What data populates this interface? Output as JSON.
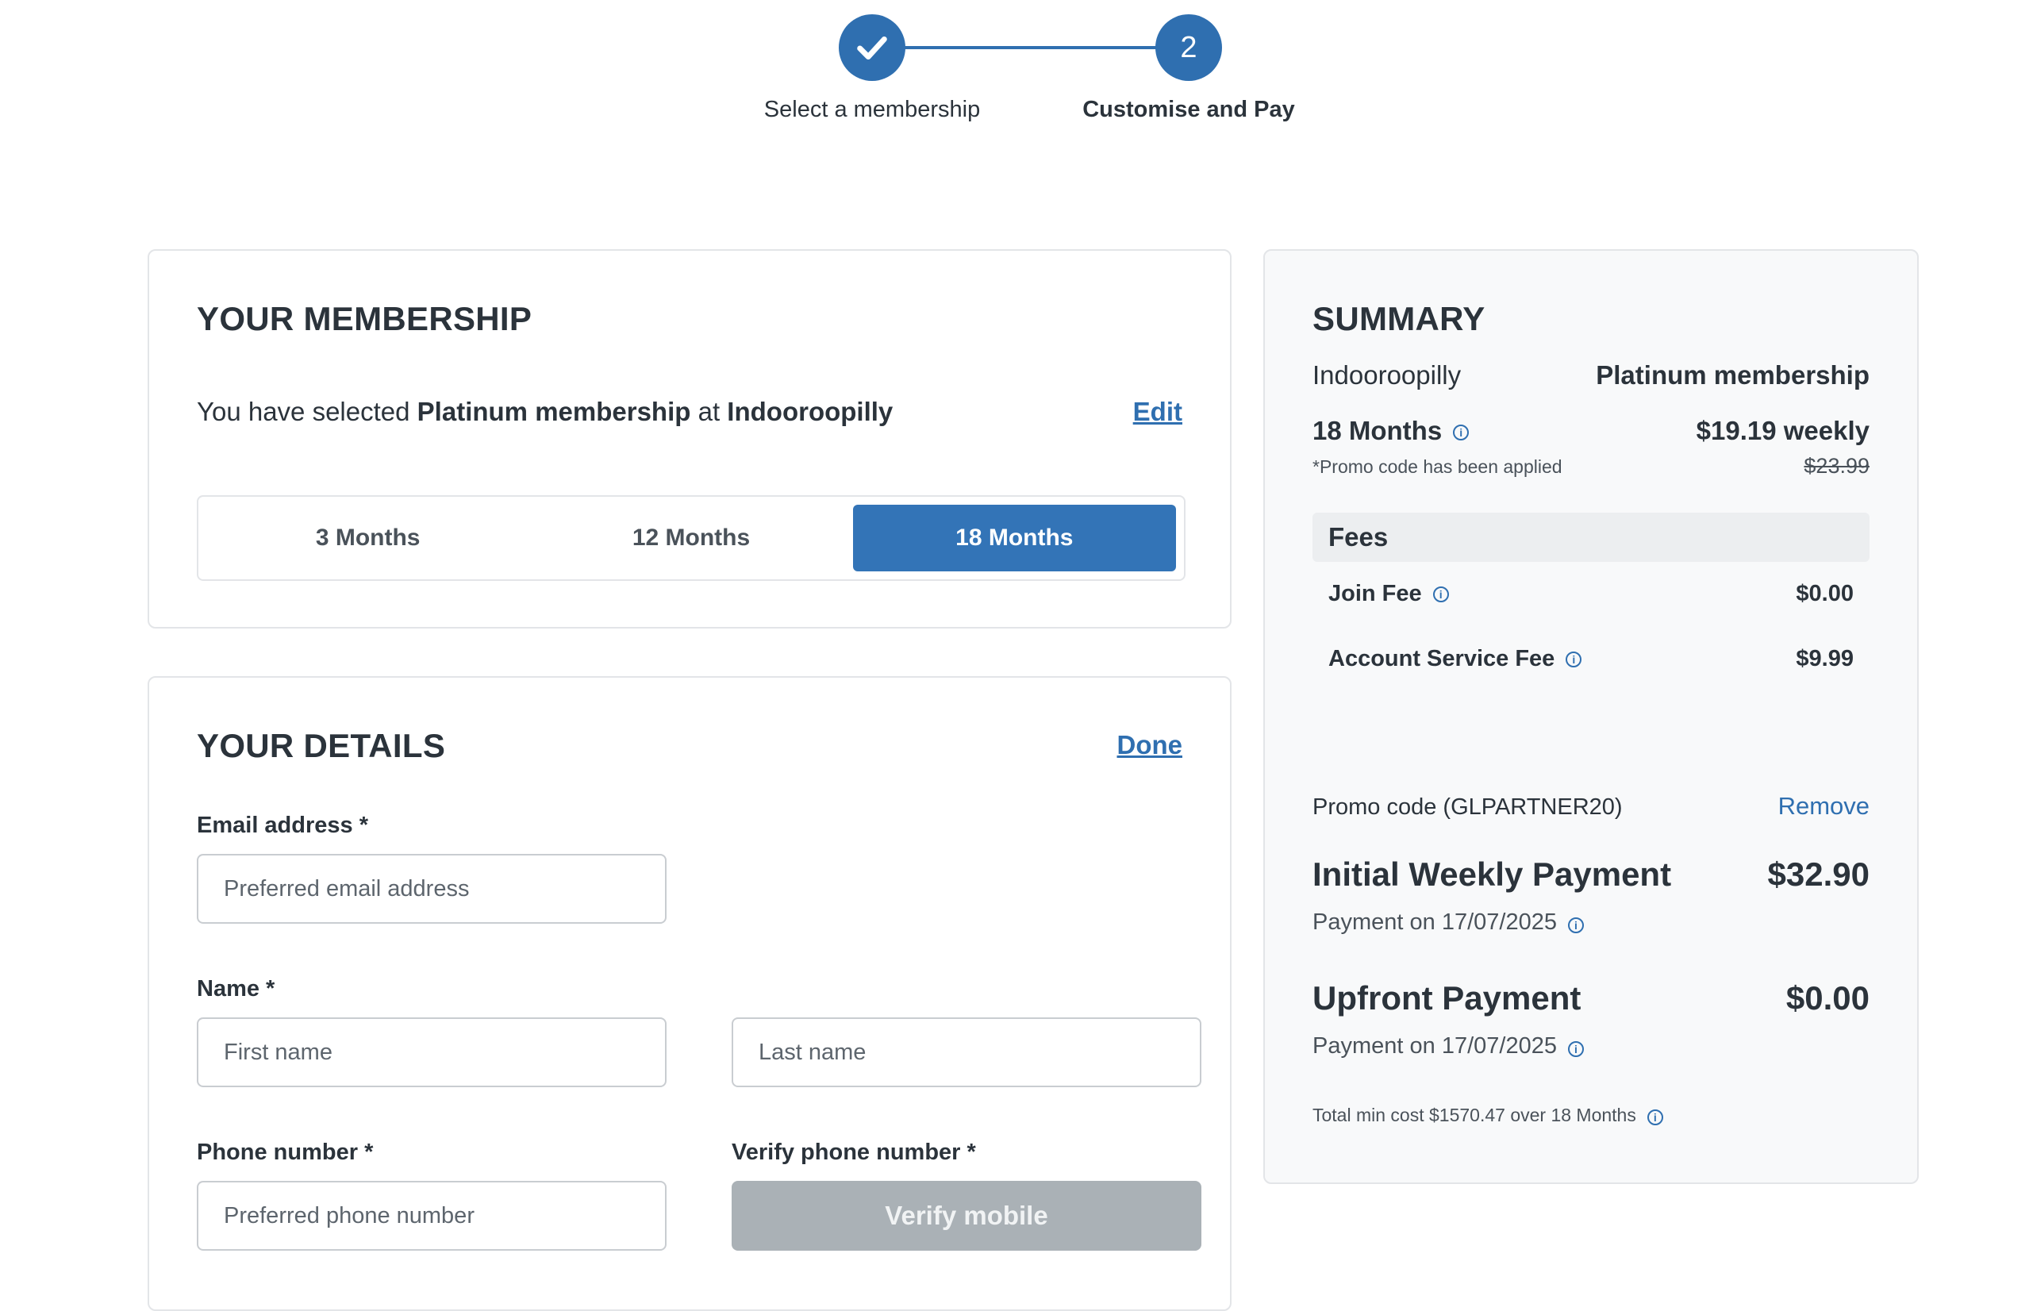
{
  "stepper": {
    "step1_label": "Select a membership",
    "step2_number": "2",
    "step2_label": "Customise and Pay"
  },
  "membership": {
    "title": "YOUR MEMBERSHIP",
    "selected_prefix": "You have selected",
    "plan": "Platinum membership",
    "at": "at",
    "location": "Indooroopilly",
    "edit_label": "Edit",
    "durations": [
      "3 Months",
      "12 Months",
      "18 Months"
    ],
    "selected_duration": "18 Months"
  },
  "details": {
    "title": "YOUR DETAILS",
    "done_label": "Done",
    "email_label": "Email address *",
    "email_placeholder": "Preferred email address",
    "name_label": "Name *",
    "first_placeholder": "First name",
    "last_placeholder": "Last name",
    "phone_label": "Phone number *",
    "phone_placeholder": "Preferred phone number",
    "verify_label": "Verify phone number *",
    "verify_button": "Verify mobile"
  },
  "summary": {
    "title": "SUMMARY",
    "location": "Indooroopilly",
    "plan": "Platinum membership",
    "duration": "18 Months",
    "weekly_price": "$19.19 weekly",
    "promo_note": "*Promo code has been applied",
    "original_price": "$23.99",
    "fees_title": "Fees",
    "join_fee_label": "Join Fee",
    "join_fee_value": "$0.00",
    "service_fee_label": "Account Service Fee",
    "service_fee_value": "$9.99",
    "promo_code_label": "Promo code (GLPARTNER20)",
    "remove_label": "Remove",
    "initial_title": "Initial Weekly Payment",
    "initial_amount": "$32.90",
    "initial_sub": "Payment on 17/07/2025",
    "upfront_title": "Upfront Payment",
    "upfront_amount": "$0.00",
    "upfront_sub": "Payment on 17/07/2025",
    "total_note": "Total min cost $1570.47 over 18 Months"
  },
  "colors": {
    "accent": "#2f6fb0",
    "active_toggle": "#3374b7",
    "disabled_button": "#aab1b6"
  }
}
